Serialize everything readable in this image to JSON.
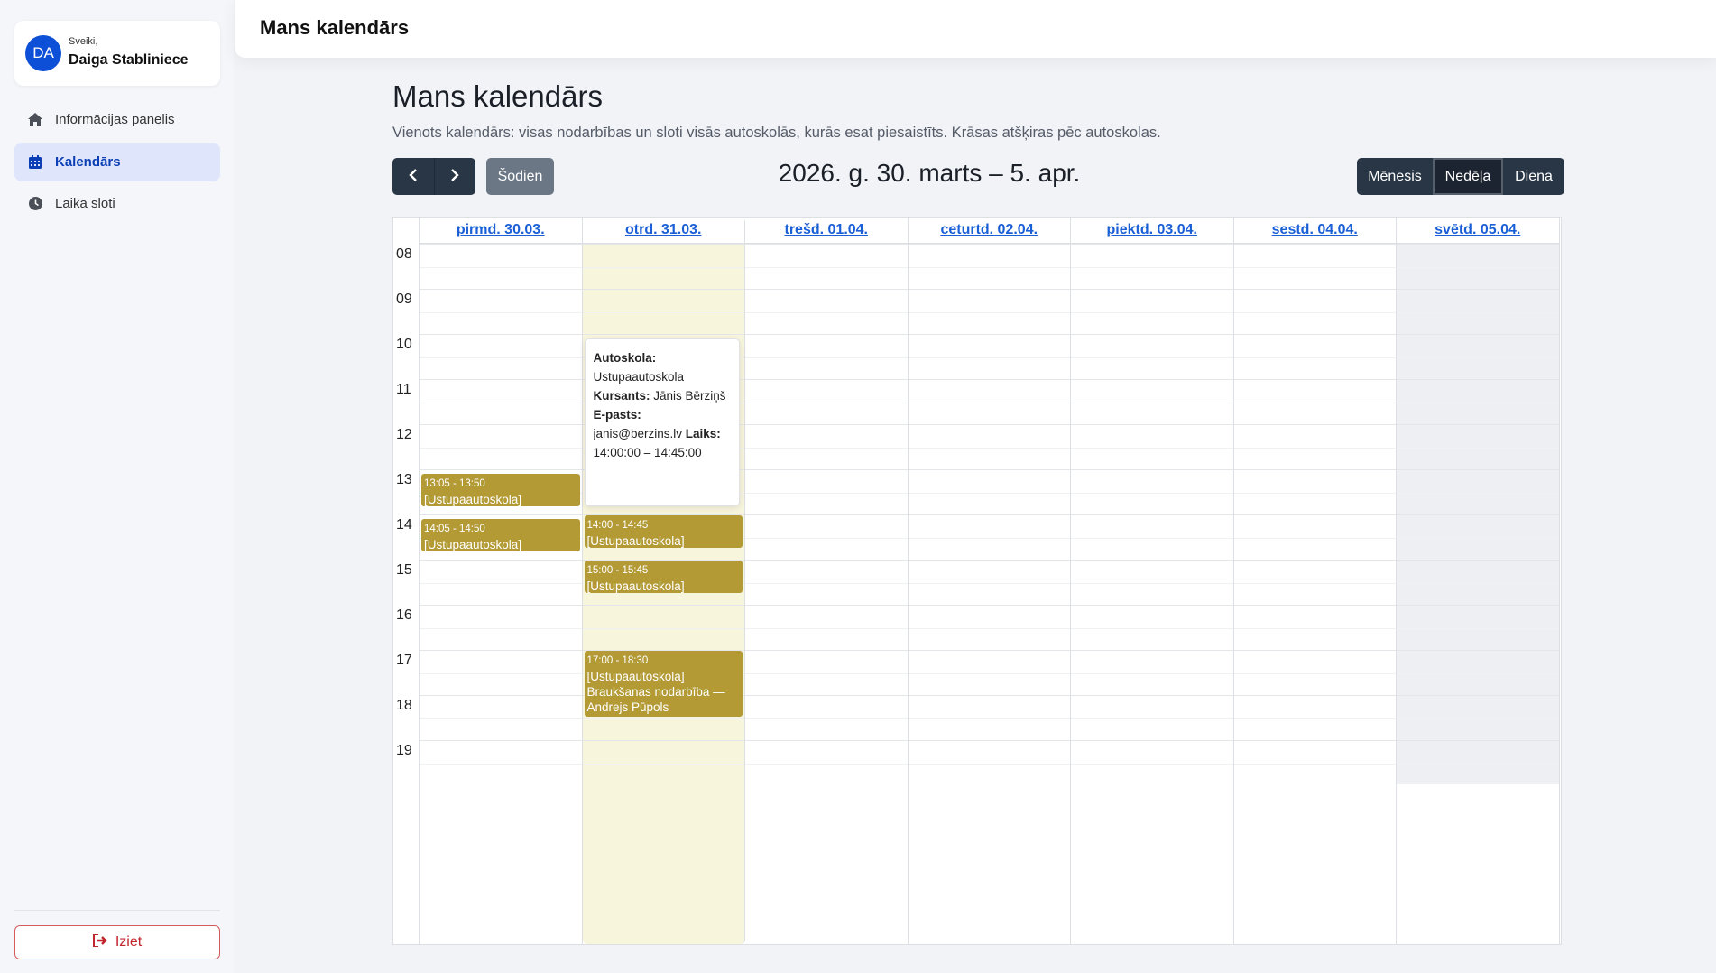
{
  "user": {
    "initials": "DA",
    "greeting": "Sveiki,",
    "name": "Daiga Stabliniece"
  },
  "nav": [
    {
      "label": "Informācijas panelis",
      "icon": "home-icon",
      "active": false
    },
    {
      "label": "Kalendārs",
      "icon": "calendar-icon",
      "active": true
    },
    {
      "label": "Laika sloti",
      "icon": "clock-icon",
      "active": false
    }
  ],
  "logout_label": "Iziet",
  "topbar_title": "Mans kalendārs",
  "page": {
    "title": "Mans kalendārs",
    "subtitle": "Vienots kalendārs: visas nodarbības un sloti visās autoskolās, kurās esat piesaistīts. Krāsas atšķiras pēc autoskolas."
  },
  "toolbar": {
    "today": "Šodien",
    "range": "2026. g. 30. marts – 5. apr.",
    "views": [
      "Mēnesis",
      "Nedēļa",
      "Diena"
    ],
    "active_view": "Nedēļa"
  },
  "days": [
    "pirmd. 30.03.",
    "otrd. 31.03.",
    "trešd. 01.04.",
    "ceturtd. 02.04.",
    "piektd. 03.04.",
    "sestd. 04.04.",
    "svētd. 05.04."
  ],
  "today_index": 1,
  "weekend_index": 6,
  "hours": [
    "08",
    "09",
    "10",
    "11",
    "12",
    "13",
    "14",
    "15",
    "16",
    "17",
    "18",
    "19"
  ],
  "events": [
    {
      "day": 0,
      "start": 13.083,
      "end": 13.833,
      "time": "13:05 - 13:50",
      "text": "[Ustupaautoskola]"
    },
    {
      "day": 0,
      "start": 14.083,
      "end": 14.833,
      "time": "14:05 - 14:50",
      "text": "[Ustupaautoskola]"
    },
    {
      "day": 1,
      "start": 14.0,
      "end": 14.75,
      "time": "14:00 - 14:45",
      "text": "[Ustupaautoskola]"
    },
    {
      "day": 1,
      "start": 15.0,
      "end": 15.75,
      "time": "15:00 - 15:45",
      "text": "[Ustupaautoskola]"
    },
    {
      "day": 1,
      "start": 17.0,
      "end": 18.5,
      "time": "17:00 - 18:30",
      "text": "[Ustupaautoskola] Braukšanas nodarbība — Andrejs Pūpols"
    }
  ],
  "tooltip": {
    "school_label": "Autoskola:",
    "school": "Ustupaautoskola",
    "student_label": "Kursants:",
    "student": "Jānis Bērziņš",
    "email_label": "E-pasts:",
    "email": "janis@berzins.lv",
    "time_label": "Laiks:",
    "time": "14:00:00 – 14:45:00"
  }
}
